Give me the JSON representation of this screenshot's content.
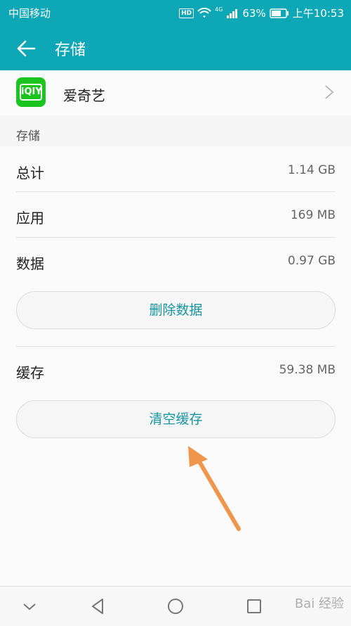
{
  "status_bar": {
    "carrier": "中国移动",
    "hd_badge": "HD",
    "network": "4G",
    "battery": "63%",
    "time": "上午10:53",
    "icons": [
      "hd-icon",
      "wifi-icon",
      "signal-icon",
      "battery-icon"
    ]
  },
  "app_bar": {
    "title": "存储",
    "back_icon": "back-arrow-icon"
  },
  "app_card": {
    "name": "爱奇艺",
    "logo_text": "iQIY",
    "logo_color": "#1cc41f",
    "chevron_icon": "chevron-right-icon"
  },
  "section_label": "存储",
  "storage": {
    "rows": [
      {
        "label": "总计",
        "value": "1.14 GB"
      },
      {
        "label": "应用",
        "value": "169 MB"
      },
      {
        "label": "数据",
        "value": "0.97 GB"
      }
    ],
    "delete_button": "删除数据"
  },
  "cache": {
    "label": "缓存",
    "value": "59.38 MB",
    "clear_button": "清空缓存"
  },
  "nav": {
    "icons": [
      "chevron-down-icon",
      "back-triangle-icon",
      "home-circle-icon",
      "recents-square-icon"
    ]
  },
  "watermark": "Bai 经验",
  "colors": {
    "accent": "#0ea7b5",
    "button_text": "#1596a3",
    "annotation_arrow": "#f0964a"
  }
}
